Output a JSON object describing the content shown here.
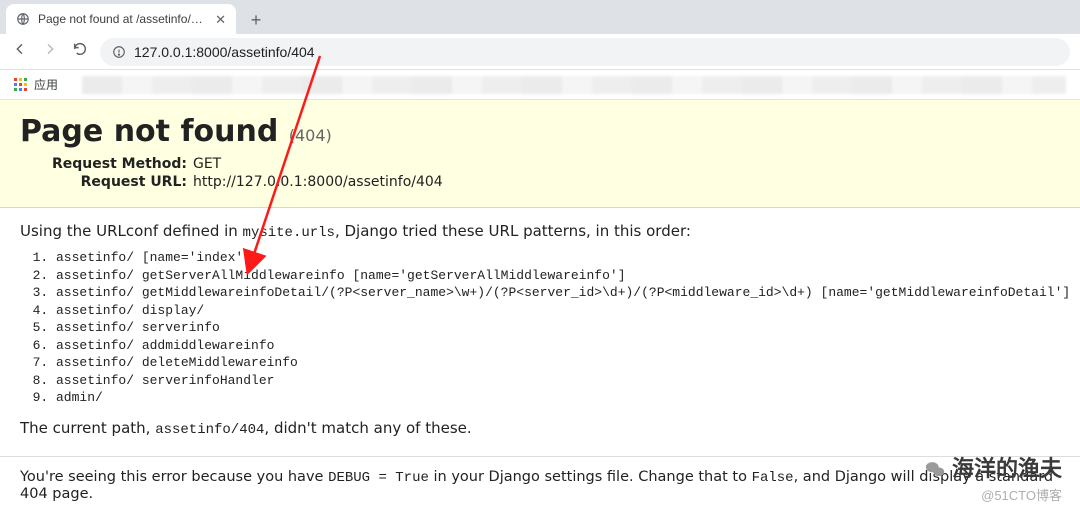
{
  "browser": {
    "tab_title": "Page not found at /assetinfo/404",
    "new_tab": "+",
    "url_display": "127.0.0.1:8000/assetinfo/404",
    "apps_label": "应用"
  },
  "error": {
    "heading": "Page not found",
    "small": "(404)",
    "method_label": "Request Method:",
    "method_value": "GET",
    "url_label": "Request URL:",
    "url_value": "http://127.0.0.1:8000/assetinfo/404"
  },
  "info": {
    "intro_before": "Using the URLconf defined in ",
    "intro_code": "mysite.urls",
    "intro_after": ", Django tried these URL patterns, in this order:",
    "patterns": [
      "assetinfo/ [name='index']",
      "assetinfo/ getServerAllMiddlewareinfo [name='getServerAllMiddlewareinfo']",
      "assetinfo/ getMiddlewareinfoDetail/(?P<server_name>\\w+)/(?P<server_id>\\d+)/(?P<middleware_id>\\d+) [name='getMiddlewareinfoDetail']",
      "assetinfo/ display/",
      "assetinfo/ serverinfo",
      "assetinfo/ addmiddlewareinfo",
      "assetinfo/ deleteMiddlewareinfo",
      "assetinfo/ serverinfoHandler",
      "admin/"
    ],
    "outro_before": "The current path, ",
    "outro_code": "assetinfo/404",
    "outro_after": ", didn't match any of these."
  },
  "explain": {
    "t1": "You're seeing this error because you have ",
    "c1": "DEBUG = True",
    "t2": " in your Django settings file. Change that to ",
    "c2": "False",
    "t3": ", and Django will display a standard 404 page."
  },
  "watermark": {
    "main": "海洋的渔夫",
    "sub": "@51CTO博客"
  }
}
